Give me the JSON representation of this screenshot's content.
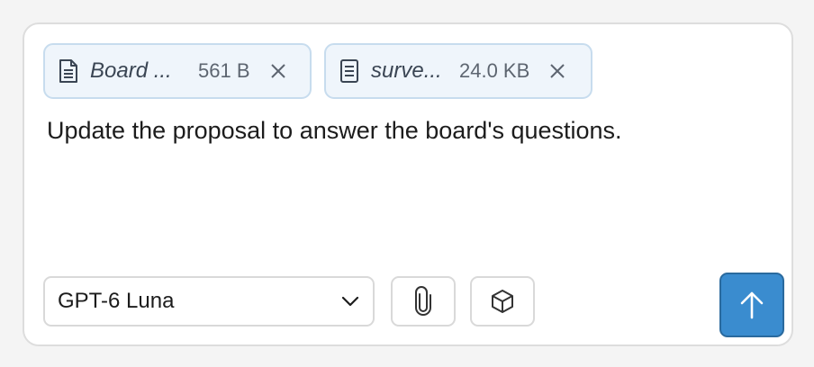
{
  "attachments": [
    {
      "name": "Board ...",
      "size": "561 B",
      "icon": "document-icon"
    },
    {
      "name": "surve...",
      "size": "24.0 KB",
      "icon": "document-icon"
    }
  ],
  "message": {
    "text": "Update the proposal to answer the board's questions."
  },
  "toolbar": {
    "model_selected": "GPT-6 Luna",
    "attach_icon": "paperclip-icon",
    "tools_icon": "cube-icon",
    "send_icon": "arrow-up-icon"
  },
  "colors": {
    "chip_bg": "#eff5fb",
    "chip_border": "#c7dcee",
    "send_bg": "#3a8ccf"
  }
}
